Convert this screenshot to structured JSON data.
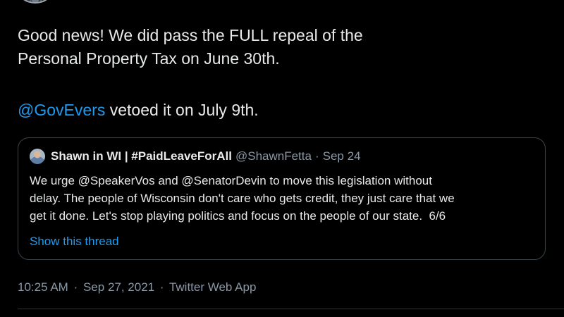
{
  "tweet": {
    "text_line_1": "Good news! We did pass the FULL repeal of the",
    "text_line_2": "Personal Property Tax on June 30th.",
    "mention": "@GovEvers",
    "text_line_3_rest": " vetoed it on July 9th."
  },
  "quoted_tweet": {
    "display_name": "Shawn in WI | #PaidLeaveForAll",
    "handle": "@ShawnFetta",
    "separator": "·",
    "date": "Sep 24",
    "body_lines": [
      "We urge @SpeakerVos and @SenatorDevin to move this legislation without",
      "delay. The people of Wisconsin don't care who gets credit, they just care that we",
      "get it done. Let's stop playing politics and focus on the people of our state.  6/6"
    ],
    "show_thread_label": "Show this thread"
  },
  "meta": {
    "time": "10:25 AM",
    "separator": "·",
    "date": "Sep 27, 2021",
    "source": "Twitter Web App"
  },
  "colors": {
    "background": "#000000",
    "text": "#e7e9ea",
    "link": "#1d9bf0",
    "secondary": "#8b98a5",
    "border": "#38444d"
  }
}
